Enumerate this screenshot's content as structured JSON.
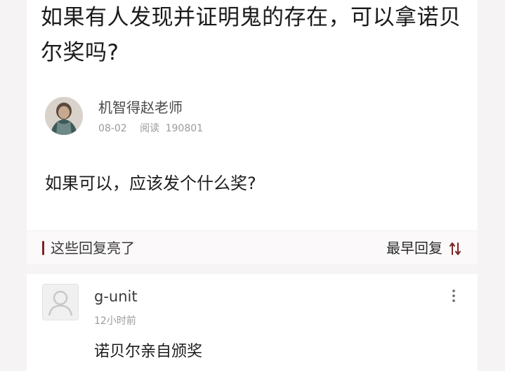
{
  "question": {
    "title": "如果有人发现并证明鬼的存在，可以拿诺贝尔奖吗?",
    "body": "如果可以，应该发个什么奖?"
  },
  "author": {
    "name": "机智得赵老师",
    "date": "08-02",
    "read_label": "阅读",
    "read_count": "190801"
  },
  "replies_section": {
    "label": "这些回复亮了",
    "sort_label": "最早回复",
    "accent_color": "#7a2626"
  },
  "replies": [
    {
      "user": "g-unit",
      "time": "12小时前",
      "text": "诺贝尔亲自颁奖"
    }
  ],
  "icons": {
    "author_avatar": "portrait-avatar-icon",
    "reply_avatar": "default-user-avatar-icon",
    "sort": "sort-arrows-icon",
    "more": "more-vertical-icon"
  }
}
